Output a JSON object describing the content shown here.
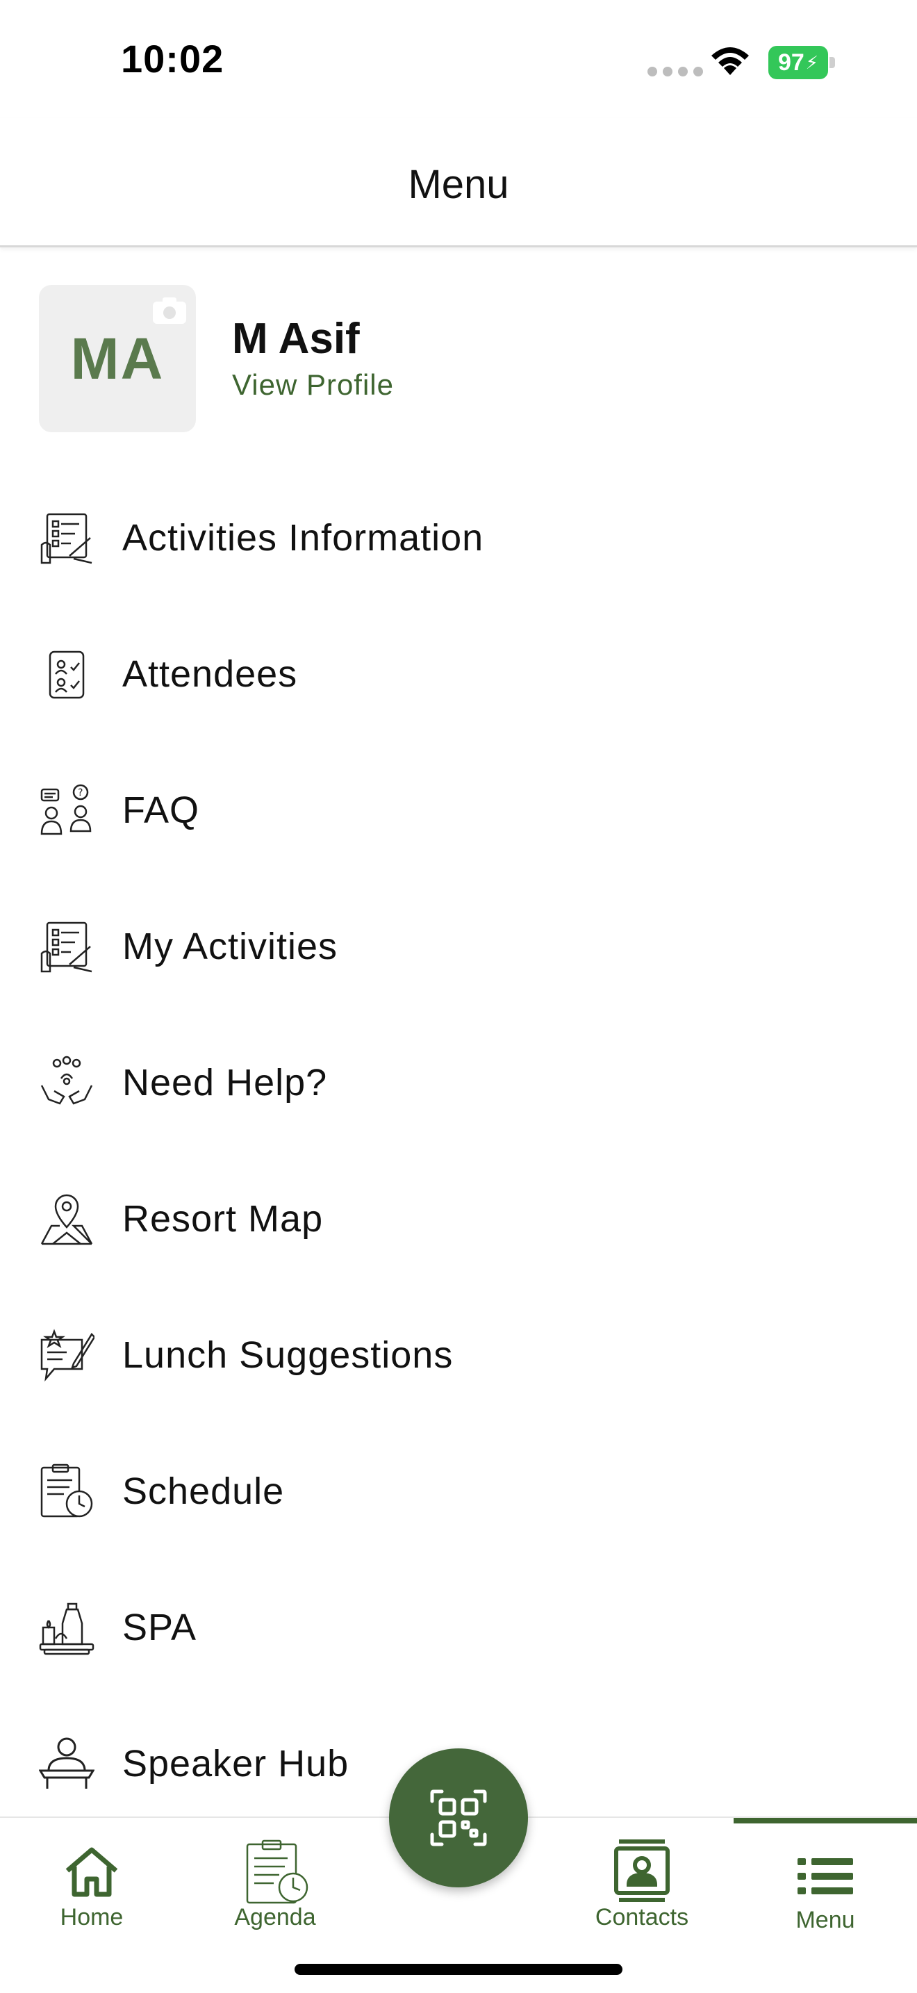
{
  "status_bar": {
    "time": "10:02",
    "battery": "97"
  },
  "header": {
    "title": "Menu"
  },
  "profile": {
    "initials": "MA",
    "name": "M Asif",
    "link": "View Profile"
  },
  "menu": {
    "items": [
      {
        "label": "Activities Information",
        "icon": "activities-clipboard-icon"
      },
      {
        "label": "Attendees",
        "icon": "attendees-list-icon"
      },
      {
        "label": "FAQ",
        "icon": "faq-people-icon"
      },
      {
        "label": "My Activities",
        "icon": "my-activities-clipboard-icon"
      },
      {
        "label": "Need Help?",
        "icon": "helping-hands-icon"
      },
      {
        "label": "Resort Map",
        "icon": "map-pin-icon"
      },
      {
        "label": "Lunch Suggestions",
        "icon": "suggestion-chat-icon"
      },
      {
        "label": "Schedule",
        "icon": "schedule-clock-icon"
      },
      {
        "label": "SPA",
        "icon": "spa-icon"
      },
      {
        "label": "Speaker Hub",
        "icon": "speaker-desk-icon"
      }
    ]
  },
  "tab_bar": {
    "home": "Home",
    "agenda": "Agenda",
    "contacts": "Contacts",
    "menu": "Menu",
    "active": "Menu"
  },
  "colors": {
    "accent": "#3e6530",
    "fab": "#44673a",
    "battery": "#33c759"
  }
}
